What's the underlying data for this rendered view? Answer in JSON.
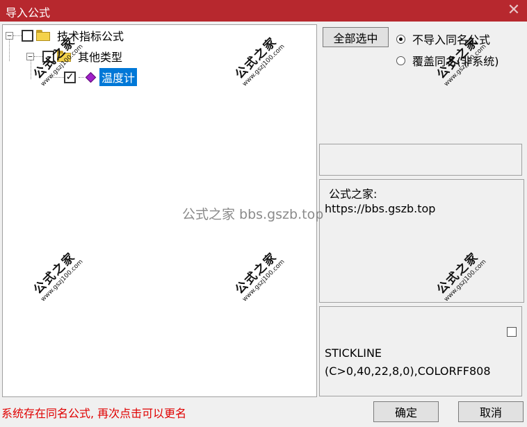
{
  "window": {
    "title": "导入公式",
    "close_icon": "close-icon"
  },
  "tree": {
    "root": {
      "label": "技术指标公式",
      "expander": "⊟",
      "checked": false
    },
    "child": {
      "label": "其他类型",
      "expander": "⊟",
      "checked": false
    },
    "leaf": {
      "label": "温度计",
      "checked": true,
      "check_mark": "✓"
    }
  },
  "controls": {
    "select_all_label": "全部选中",
    "radio_no_import_label": "不导入同名公式",
    "radio_overwrite_label": "覆盖同名(非系统)"
  },
  "info": {
    "line1": "公式之家:",
    "line2": "https://bbs.gszb.top"
  },
  "code": {
    "line1": "STICKLINE",
    "line2": "(C>0,40,22,8,0),COLORFF808"
  },
  "status_text": "系统存在同名公式, 再次点击可以更名",
  "buttons": {
    "ok_label": "确定",
    "cancel_label": "取消"
  },
  "watermark_text": "公式之家 bbs.gszb.top",
  "stamp": {
    "big": "公式之家",
    "small": "www.gszj100.com"
  },
  "colors": {
    "titlebar": "#b7282e",
    "selection": "#0078d7",
    "status": "#e00000"
  }
}
